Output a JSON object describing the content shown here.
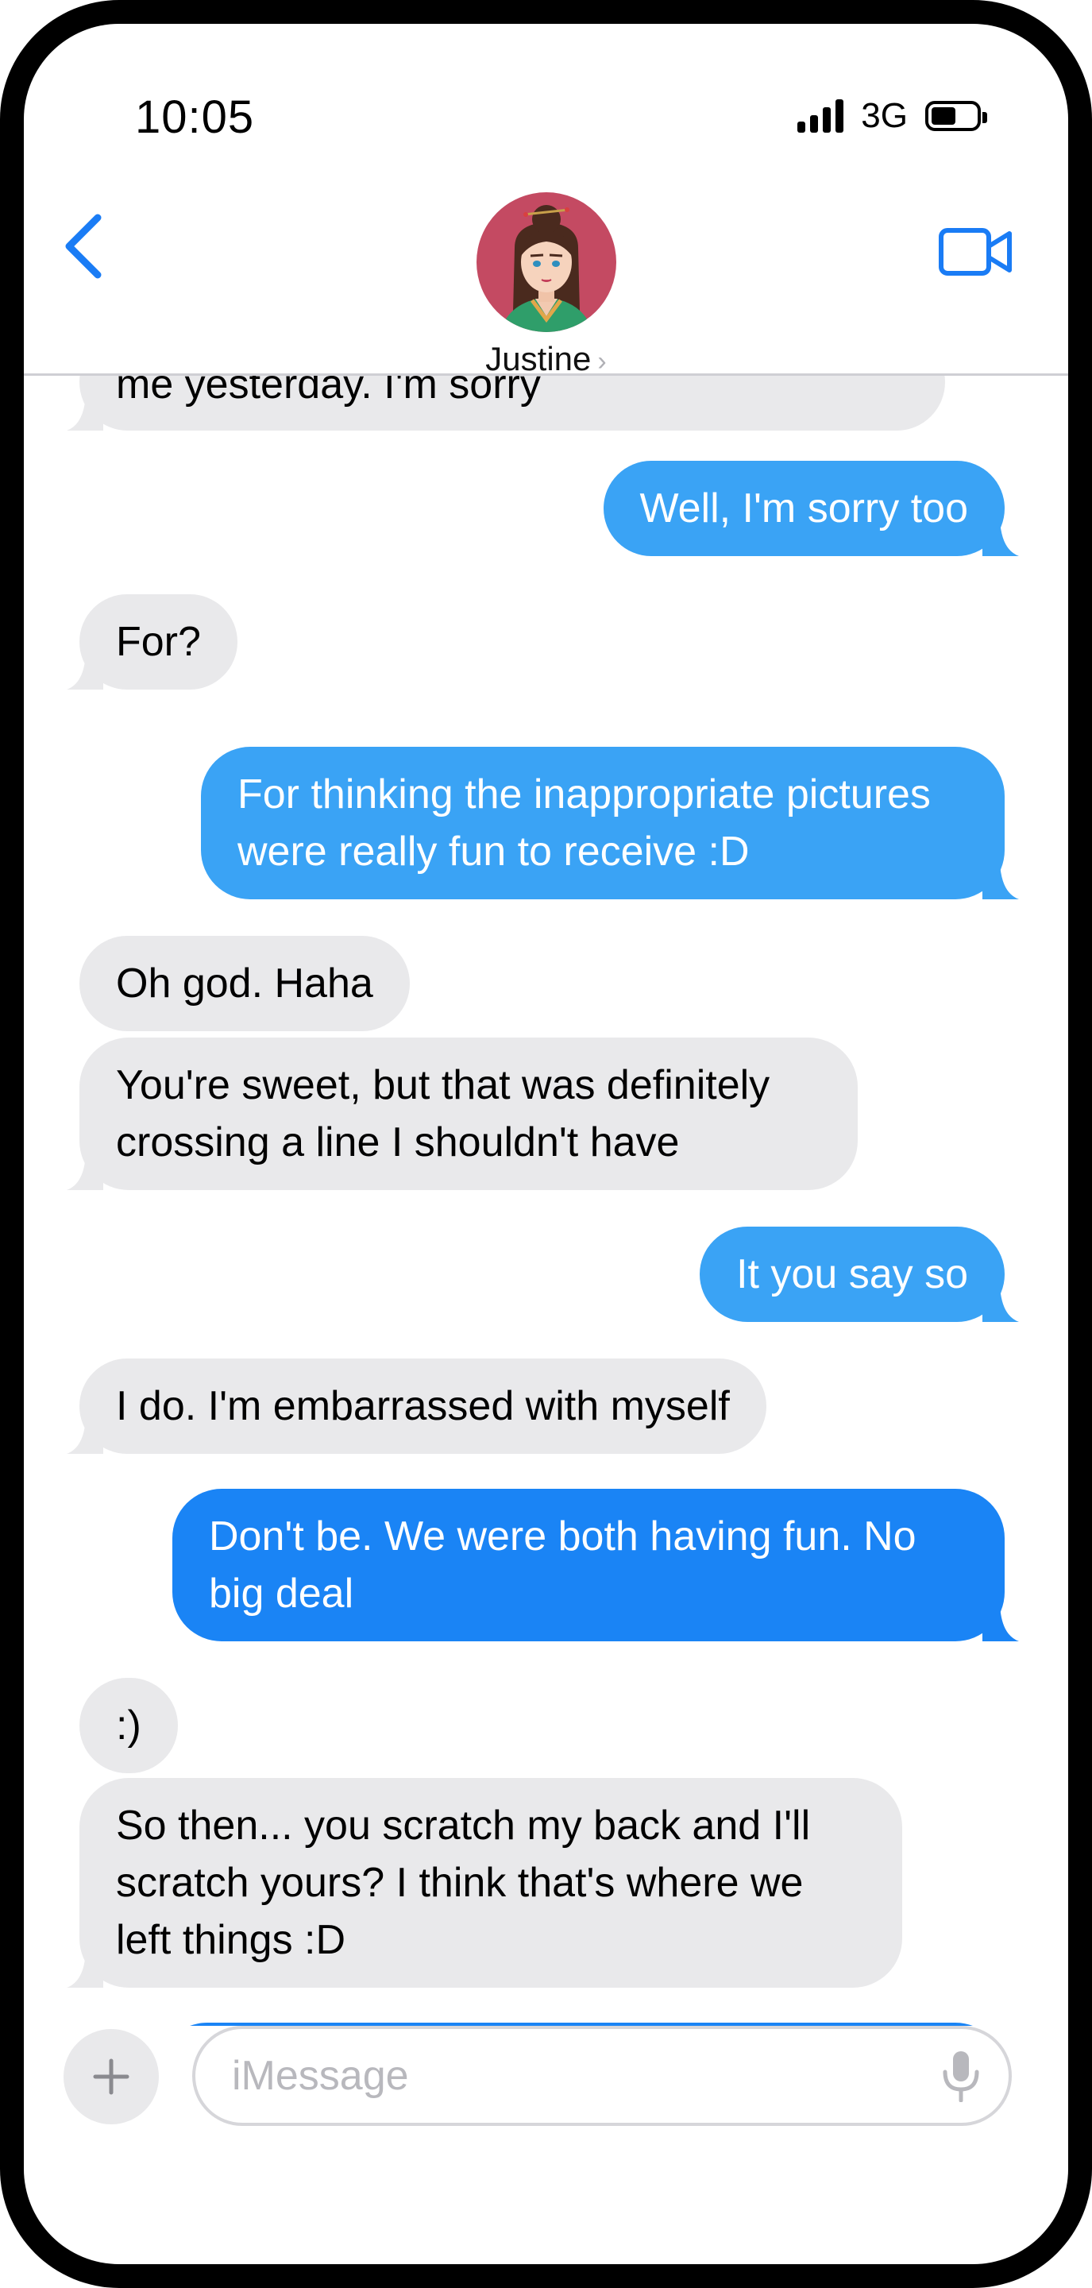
{
  "status_bar": {
    "time": "10:05",
    "network": "3G"
  },
  "header": {
    "contact_name": "Justine",
    "chevron": "›"
  },
  "messages": [
    {
      "side": "in",
      "text": "me yesterday.  I'm sorry"
    },
    {
      "side": "out",
      "text": "Well, I'm sorry too"
    },
    {
      "side": "in",
      "text": "For?"
    },
    {
      "side": "out",
      "text": "For thinking the inappropriate pictures were really fun to receive :D"
    },
    {
      "side": "in",
      "text": "Oh god.  Haha"
    },
    {
      "side": "in",
      "text": "You're sweet, but that was definitely crossing a line I shouldn't have"
    },
    {
      "side": "out",
      "text": "It you say so"
    },
    {
      "side": "in",
      "text": "I do.  I'm embarrassed with myself"
    },
    {
      "side": "out",
      "text": "Don't be.  We were both having fun.  No big deal"
    },
    {
      "side": "in",
      "text": ":)"
    },
    {
      "side": "in",
      "text": "So then... you scratch my back and I'll scratch yours?  I think that's where we left things :D"
    },
    {
      "side": "out",
      "text": ""
    }
  ],
  "input": {
    "placeholder": "iMessage"
  },
  "colors": {
    "accent": "#1a7cf5",
    "outgoing_light": "#3aa3f5",
    "outgoing_dark": "#1a84f5",
    "incoming": "#e9e9eb"
  },
  "icons": {
    "back": "chevron-left-icon",
    "video": "video-camera-icon",
    "plus": "plus-icon",
    "mic": "microphone-icon"
  }
}
